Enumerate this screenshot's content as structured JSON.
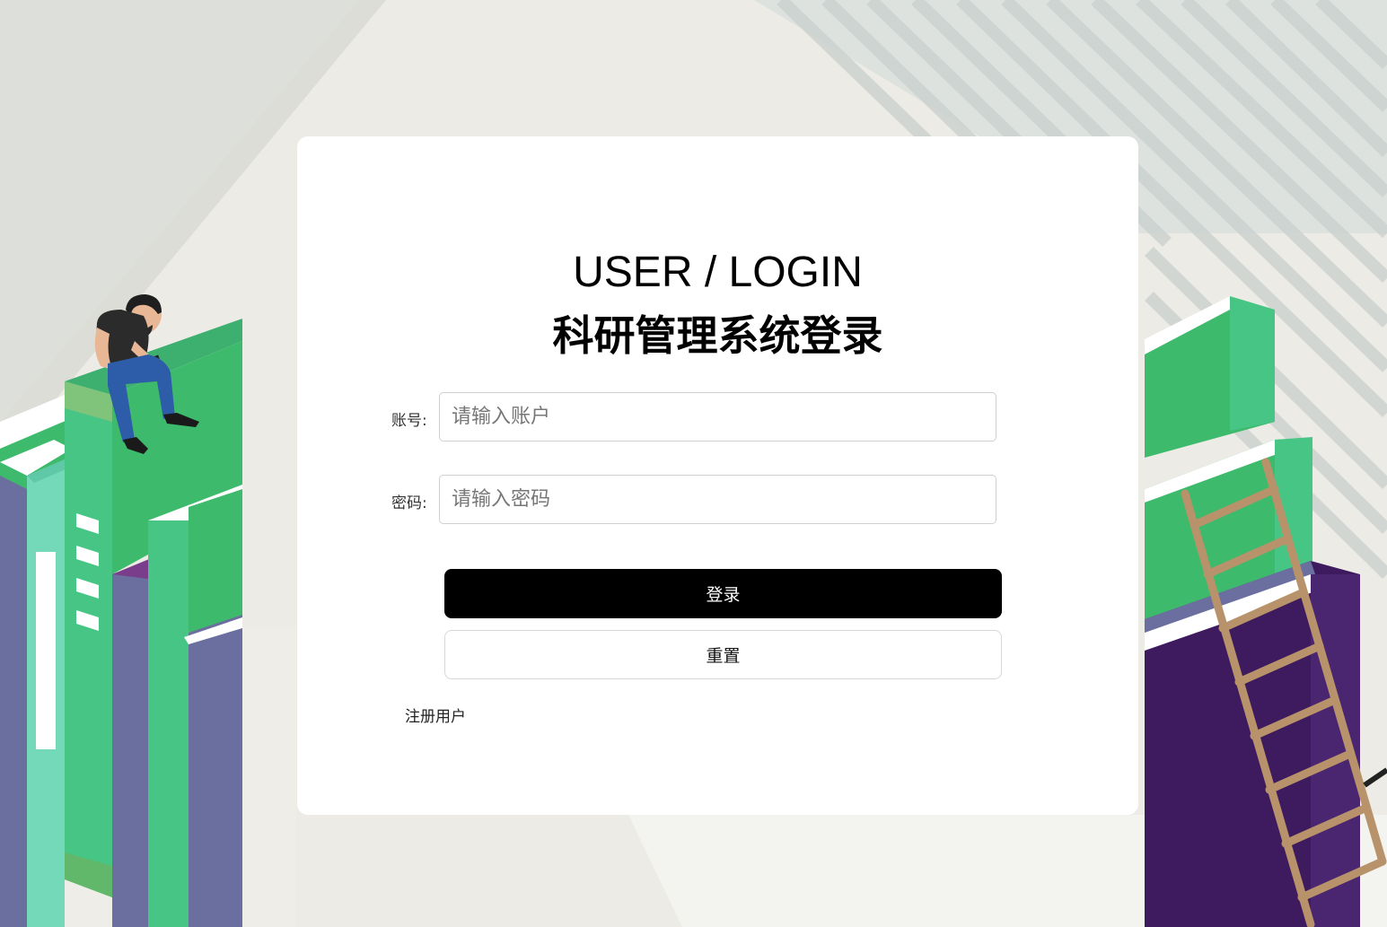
{
  "header": {
    "title_en": "USER / LOGIN",
    "title_cn": "科研管理系统登录"
  },
  "form": {
    "account_label": "账号:",
    "account_placeholder": "请输入账户",
    "account_value": "",
    "password_label": "密码:",
    "password_placeholder": "请输入密码",
    "password_value": ""
  },
  "buttons": {
    "login_label": "登录",
    "reset_label": "重置"
  },
  "links": {
    "register_label": "注册用户"
  },
  "colors": {
    "primary_button": "#000000",
    "card_background": "#ffffff",
    "book_green": "#3dba6b",
    "book_purple": "#6c6f9e",
    "book_dark_purple": "#3e1b5e",
    "ladder": "#b8926a"
  }
}
